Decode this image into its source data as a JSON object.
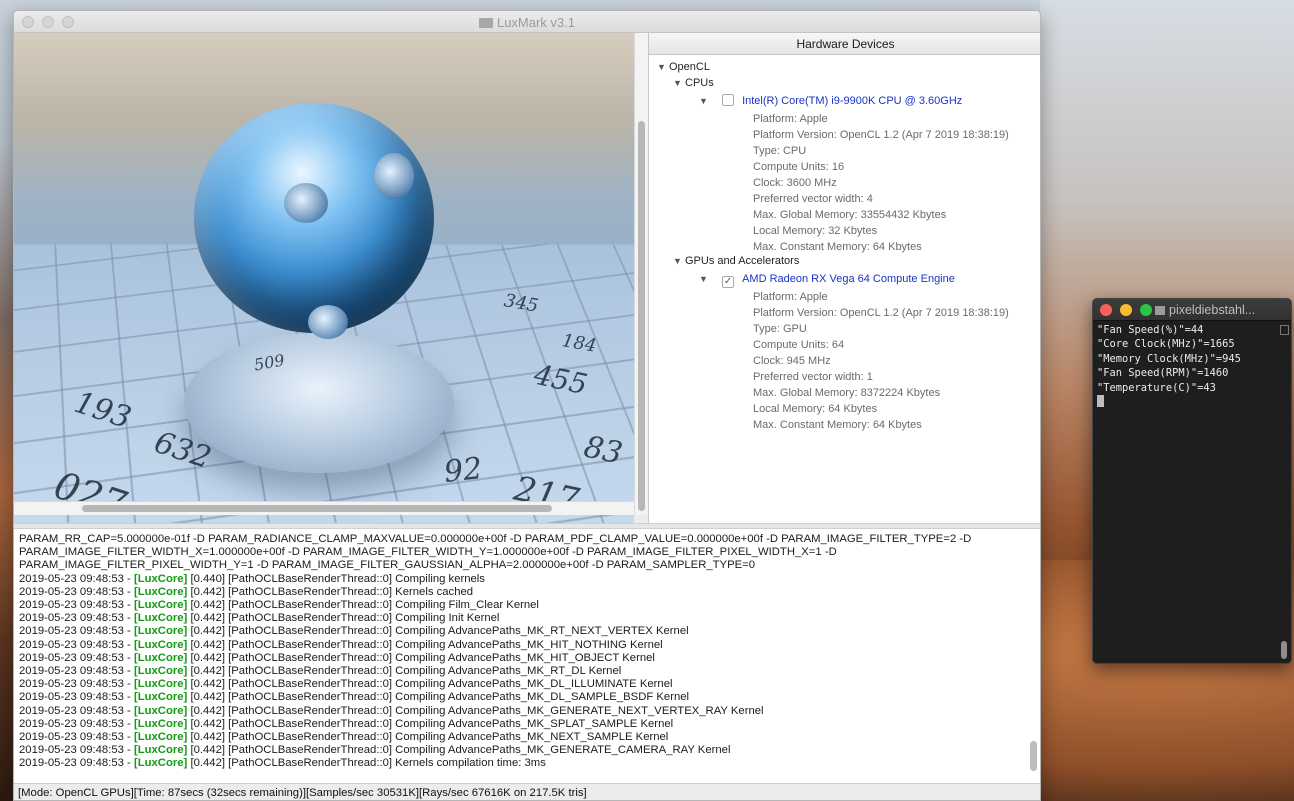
{
  "window": {
    "title": "LuxMark v3.1"
  },
  "hardware": {
    "header": "Hardware Devices",
    "platform_group": "OpenCL",
    "cpu_group": "CPUs",
    "gpu_group": "GPUs and Accelerators",
    "cpu": {
      "name": "Intel(R) Core(TM) i9-9900K CPU @ 3.60GHz",
      "checked": false,
      "props": [
        "Platform: Apple",
        "Platform Version: OpenCL 1.2 (Apr  7 2019 18:38:19)",
        "Type: CPU",
        "Compute Units: 16",
        "Clock: 3600 MHz",
        "Preferred vector width: 4",
        "Max. Global Memory: 33554432 Kbytes",
        "Local Memory: 32 Kbytes",
        "Max. Constant Memory: 64 Kbytes"
      ]
    },
    "gpu": {
      "name": "AMD Radeon RX Vega 64 Compute Engine",
      "checked": true,
      "props": [
        "Platform: Apple",
        "Platform Version: OpenCL 1.2 (Apr  7 2019 18:38:19)",
        "Type: GPU",
        "Compute Units: 64",
        "Clock: 945 MHz",
        "Preferred vector width: 1",
        "Max. Global Memory: 8372224 Kbytes",
        "Local Memory: 64 Kbytes",
        "Max. Constant Memory: 64 Kbytes"
      ]
    }
  },
  "render": {
    "numbers": [
      "193",
      "632",
      "027",
      "217",
      "455",
      "83",
      "92",
      "184",
      "345",
      "509",
      "027",
      "217"
    ]
  },
  "log": {
    "params": [
      "PARAM_RR_CAP=5.000000e-01f -D PARAM_RADIANCE_CLAMP_MAXVALUE=0.000000e+00f -D PARAM_PDF_CLAMP_VALUE=0.000000e+00f -D PARAM_IMAGE_FILTER_TYPE=2 -D",
      "PARAM_IMAGE_FILTER_WIDTH_X=1.000000e+00f -D PARAM_IMAGE_FILTER_WIDTH_Y=1.000000e+00f -D PARAM_IMAGE_FILTER_PIXEL_WIDTH_X=1 -D",
      "PARAM_IMAGE_FILTER_PIXEL_WIDTH_Y=1 -D PARAM_IMAGE_FILTER_GAUSSIAN_ALPHA=2.000000e+00f -D PARAM_SAMPLER_TYPE=0"
    ],
    "entries": [
      {
        "ts": "2019-05-23 09:48:53 - ",
        "tag": "[LuxCore]",
        "msg": " [0.440] [PathOCLBaseRenderThread::0] Compiling kernels"
      },
      {
        "ts": "2019-05-23 09:48:53 - ",
        "tag": "[LuxCore]",
        "msg": " [0.442] [PathOCLBaseRenderThread::0] Kernels cached"
      },
      {
        "ts": "2019-05-23 09:48:53 - ",
        "tag": "[LuxCore]",
        "msg": " [0.442] [PathOCLBaseRenderThread::0] Compiling Film_Clear Kernel"
      },
      {
        "ts": "2019-05-23 09:48:53 - ",
        "tag": "[LuxCore]",
        "msg": " [0.442] [PathOCLBaseRenderThread::0] Compiling Init Kernel"
      },
      {
        "ts": "2019-05-23 09:48:53 - ",
        "tag": "[LuxCore]",
        "msg": " [0.442] [PathOCLBaseRenderThread::0] Compiling AdvancePaths_MK_RT_NEXT_VERTEX Kernel"
      },
      {
        "ts": "2019-05-23 09:48:53 - ",
        "tag": "[LuxCore]",
        "msg": " [0.442] [PathOCLBaseRenderThread::0] Compiling AdvancePaths_MK_HIT_NOTHING Kernel"
      },
      {
        "ts": "2019-05-23 09:48:53 - ",
        "tag": "[LuxCore]",
        "msg": " [0.442] [PathOCLBaseRenderThread::0] Compiling AdvancePaths_MK_HIT_OBJECT Kernel"
      },
      {
        "ts": "2019-05-23 09:48:53 - ",
        "tag": "[LuxCore]",
        "msg": " [0.442] [PathOCLBaseRenderThread::0] Compiling AdvancePaths_MK_RT_DL Kernel"
      },
      {
        "ts": "2019-05-23 09:48:53 - ",
        "tag": "[LuxCore]",
        "msg": " [0.442] [PathOCLBaseRenderThread::0] Compiling AdvancePaths_MK_DL_ILLUMINATE Kernel"
      },
      {
        "ts": "2019-05-23 09:48:53 - ",
        "tag": "[LuxCore]",
        "msg": " [0.442] [PathOCLBaseRenderThread::0] Compiling AdvancePaths_MK_DL_SAMPLE_BSDF Kernel"
      },
      {
        "ts": "2019-05-23 09:48:53 - ",
        "tag": "[LuxCore]",
        "msg": " [0.442] [PathOCLBaseRenderThread::0] Compiling AdvancePaths_MK_GENERATE_NEXT_VERTEX_RAY Kernel"
      },
      {
        "ts": "2019-05-23 09:48:53 - ",
        "tag": "[LuxCore]",
        "msg": " [0.442] [PathOCLBaseRenderThread::0] Compiling AdvancePaths_MK_SPLAT_SAMPLE Kernel"
      },
      {
        "ts": "2019-05-23 09:48:53 - ",
        "tag": "[LuxCore]",
        "msg": " [0.442] [PathOCLBaseRenderThread::0] Compiling AdvancePaths_MK_NEXT_SAMPLE Kernel"
      },
      {
        "ts": "2019-05-23 09:48:53 - ",
        "tag": "[LuxCore]",
        "msg": " [0.442] [PathOCLBaseRenderThread::0] Compiling AdvancePaths_MK_GENERATE_CAMERA_RAY Kernel"
      },
      {
        "ts": "2019-05-23 09:48:53 - ",
        "tag": "[LuxCore]",
        "msg": " [0.442] [PathOCLBaseRenderThread::0] Kernels compilation time: 3ms"
      }
    ]
  },
  "status_bar": "[Mode: OpenCL GPUs][Time: 87secs (32secs remaining)][Samples/sec  30531K][Rays/sec  67616K on 217.5K tris]",
  "terminal": {
    "title": "pixeldiebstahl...",
    "lines": [
      "\"Fan Speed(%)\"=44",
      "\"Core Clock(MHz)\"=1665",
      "\"Memory Clock(MHz)\"=945",
      "\"Fan Speed(RPM)\"=1460",
      "\"Temperature(C)\"=43"
    ]
  },
  "colors": {
    "log_tag": "#149a14",
    "device_link": "#1834c6",
    "terminal_bg": "#1e1e1e"
  }
}
